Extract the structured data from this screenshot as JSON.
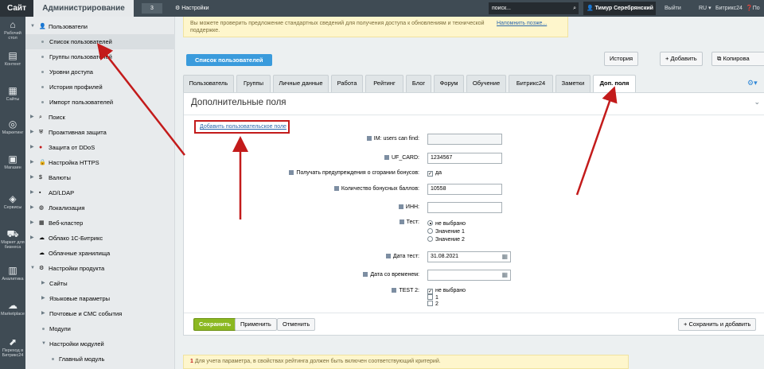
{
  "topbar": {
    "site_label": "Сайт",
    "admin_label": "Администрирование",
    "counter": "3",
    "settings_label": "Настройки",
    "search_placeholder": "поиск...",
    "user_name": "Тимур Серебрянский",
    "logout_label": "Выйти",
    "lang_label": "RU",
    "b24_label": "Битрикс24",
    "help_label": "По"
  },
  "leftbar": [
    {
      "label": "Рабочий стол",
      "icon": "desktop-icon"
    },
    {
      "label": "Контент",
      "icon": "content-icon"
    },
    {
      "label": "Сайты",
      "icon": "sites-icon"
    },
    {
      "label": "Маркетинг",
      "icon": "marketing-icon"
    },
    {
      "label": "Магазин",
      "icon": "shop-icon"
    },
    {
      "label": "Сервисы",
      "icon": "services-icon"
    },
    {
      "label": "Маркет для бизнеса",
      "icon": "market-icon"
    },
    {
      "label": "Аналитика",
      "icon": "analytics-icon"
    },
    {
      "label": "Marketplace",
      "icon": "cloud-icon"
    },
    {
      "label": "Переход в Битрикс24",
      "icon": "b24-icon"
    }
  ],
  "menu": {
    "users": "Пользователи",
    "user_list": "Список пользователей",
    "user_groups": "Группы пользователей",
    "access_levels": "Уровни доступа",
    "profile_history": "История профилей",
    "import_users": "Импорт пользователей",
    "search": "Поиск",
    "proactive": "Проактивная защита",
    "ddos": "Защита от DDoS",
    "https": "Настройка HTTPS",
    "currencies": "Валюты",
    "ad_ldap": "AD/LDAP",
    "localization": "Локализация",
    "web_cluster": "Веб-кластер",
    "cloud_1c": "Облако 1С-Битрикс",
    "cloud_storage": "Облачные хранилища",
    "product_settings": "Настройки продукта",
    "sites": "Сайты",
    "lang_params": "Языковые параметры",
    "mail_sms": "Почтовые и СМС события",
    "modules": "Модули",
    "module_settings": "Настройки модулей",
    "main_module": "Главный модуль"
  },
  "notice_top": {
    "text": "Вы можете проверить предложение стандартных сведений для получения доступа к обновлениям и технической поддержке.",
    "link": "Напомнить позже..."
  },
  "toolbar": {
    "list_button": "Список пользователей",
    "history": "История",
    "add": "Добавить",
    "copy": "Копирова"
  },
  "tabs": [
    "Пользователь",
    "Группы",
    "Личные данные",
    "Работа",
    "Рейтинг",
    "Блог",
    "Форум",
    "Обучение",
    "Битрикс24",
    "Заметки",
    "Доп. поля"
  ],
  "panel": {
    "title": "Дополнительные поля",
    "add_field_link": "Добавить пользовательское поле",
    "fields": {
      "im_label": "IM: users can find:",
      "im_value": "",
      "uf_card_label": "UF_CARD:",
      "uf_card_value": "1234567",
      "bonus_notify_label": "Получать предупреждения о сгорании бонусов:",
      "bonus_notify_value": "да",
      "bonus_count_label": "Количество бонусных баллов:",
      "bonus_count_value": "10558",
      "inn_label": "ИНН:",
      "inn_value": "",
      "test_label": "Тест:",
      "test_options": [
        "не выбрано",
        "Значение 1",
        "Значение 2"
      ],
      "date_test_label": "Дата тест:",
      "date_test_value": "31.08.2021",
      "date_time_label": "Дата со временем:",
      "date_time_value": "",
      "test2_label": "TEST 2:",
      "test2_options": [
        "не выбрано",
        "1",
        "2"
      ]
    },
    "buttons": {
      "save": "Сохранить",
      "apply": "Применить",
      "cancel": "Отменить",
      "save_add": "Сохранить и добавить"
    }
  },
  "notice_bottom": {
    "marker": "1",
    "text": "Для учета параметра, в свойствах рейтинга должен быть включен соответствующий критерий."
  },
  "colors": {
    "accent_blue": "#3a9bdc",
    "save_green": "#8bb821",
    "annotation_red": "#c31b1b",
    "panel_dark": "#3f4b54"
  }
}
